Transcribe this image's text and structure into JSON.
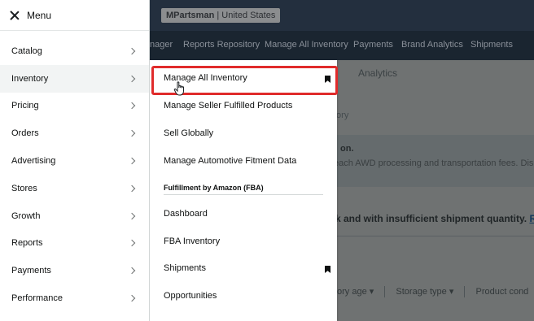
{
  "background": {
    "store_badge": {
      "name": "MPartsman",
      "region": "United States"
    },
    "nav_items": [
      {
        "label": "nager"
      },
      {
        "label": "Reports Repository"
      },
      {
        "label": "Manage All Inventory"
      },
      {
        "label": "Payments"
      },
      {
        "label": "Brand Analytics"
      },
      {
        "label": "Shipments"
      }
    ],
    "tab_label": "Analytics",
    "line1": "tory",
    "line2": "on.",
    "line3": "each AWD processing and transportation fees. Dis",
    "line4_text": "k and with insufficient shipment quantity. ",
    "line4_link": "Re",
    "filters": [
      "ory age",
      "Storage type",
      "Product cond"
    ]
  },
  "menu": {
    "title": "Menu",
    "items": [
      {
        "label": "Catalog"
      },
      {
        "label": "Inventory"
      },
      {
        "label": "Pricing"
      },
      {
        "label": "Orders"
      },
      {
        "label": "Advertising"
      },
      {
        "label": "Stores"
      },
      {
        "label": "Growth"
      },
      {
        "label": "Reports"
      },
      {
        "label": "Payments"
      },
      {
        "label": "Performance"
      }
    ],
    "active_index": 1
  },
  "submenu": {
    "items": [
      {
        "label": "Manage All Inventory",
        "bookmarked": true
      },
      {
        "label": "Manage Seller Fulfilled Products"
      },
      {
        "label": "Sell Globally"
      },
      {
        "label": "Manage Automotive Fitment Data"
      }
    ],
    "fba_heading": "Fulfillment by Amazon (FBA)",
    "fba_items": [
      {
        "label": "Dashboard"
      },
      {
        "label": "FBA Inventory"
      },
      {
        "label": "Shipments",
        "bookmarked": true
      },
      {
        "label": "Opportunities"
      }
    ]
  },
  "colors": {
    "highlight": "#e02b2b",
    "header_bg": "#232f3e"
  },
  "icons": [
    "close-icon",
    "chevron-right-icon",
    "bookmark-icon",
    "hand-cursor-icon"
  ]
}
